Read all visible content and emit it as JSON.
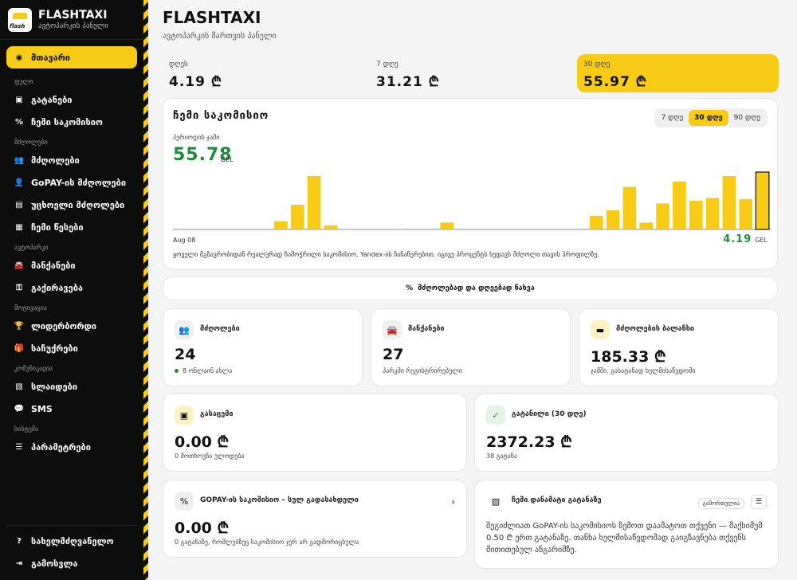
{
  "brand": {
    "title": "FLASHTAXI",
    "subtitle": "ავტოპარკის პანელი",
    "logo_text": "flash"
  },
  "sidebar": {
    "active": "მთავარი",
    "sec_money": "ფული",
    "trips": "გატანები",
    "my_commission": "ჩემი საკომისიო",
    "sec_drivers": "მძღოლები",
    "drivers": "მძღოლები",
    "gopay_drivers": "GoPAY-ის მძღოლები",
    "foreign_drivers": "უცხოელი მძღოლები",
    "my_rules": "ჩემი წესები",
    "sec_fleet": "ავტოპარკი",
    "cars": "მანქანები",
    "rental": "გაქირავება",
    "sec_motivation": "მოტივაცია",
    "leaderboard": "ლიდერბორდი",
    "gifts": "საჩუქრები",
    "sec_comm": "კომუნიკაცია",
    "slides": "სლაიდები",
    "sms": "SMS",
    "sec_system": "სისტემა",
    "settings": "პარამეტრები",
    "guide": "სახელმძღვანელო",
    "logout": "გამოსვლა"
  },
  "header": {
    "title": "FLASHTAXI",
    "subtitle": "ავტოპარკის მართვის პანელი"
  },
  "periods": [
    {
      "label": "დღეს",
      "value": "4.19 ₾"
    },
    {
      "label": "7 დღე",
      "value": "31.21 ₾"
    },
    {
      "label": "30 დღე",
      "value": "55.97 ₾"
    }
  ],
  "commission_card": {
    "title": "ჩემი საკომისიო",
    "tabs": [
      "7 დღე",
      "30 დღე",
      "90 დღე"
    ],
    "total_label": "პერიოდის ჯამი",
    "total": "55.78",
    "unit": "GEL",
    "start_date": "Aug 08",
    "last_value": "4.19",
    "last_unit": "GEL",
    "note": "ყოველი მგზავრობიდან რეალურად ჩამოჭრილი საკომისიო, Yandex-ის ჩანაწერებით. იგივე პროცენტს ხედავს მძღოლი თავის პროფილზე."
  },
  "chart_data": {
    "type": "bar",
    "title": "ჩემი საკომისიო",
    "x_start": "Aug 08",
    "values": [
      0,
      0,
      0,
      0,
      0,
      0,
      0.6,
      1.8,
      3.9,
      0.3,
      0,
      0,
      0,
      0.05,
      0,
      0,
      0.5,
      0,
      0,
      0,
      0,
      0,
      0,
      0,
      0,
      1,
      1.4,
      3.1,
      0.5,
      1.9,
      3.5,
      2.1,
      2.3,
      3.9,
      2.2
    ],
    "last_value": 4.19,
    "ylim": [
      0,
      4.19
    ],
    "grid": false
  },
  "drivers_days_button": "მძღოლებად და დღეებად ნახვა",
  "stats": {
    "drivers": {
      "title": "მძღოლები",
      "value": "24",
      "sub": "8 ონლაინ ახლა"
    },
    "cars": {
      "title": "მანქანები",
      "value": "27",
      "sub": "პარკში რეგისტრირებული"
    },
    "balance": {
      "title": "მძღოლების ბალანსი",
      "value": "185.33 ₾",
      "sub": "ჯამში, გასატანად ხელმისაწვდომი"
    },
    "expenses": {
      "title": "გასაცემი",
      "value": "0.00 ₾",
      "sub": "0 მოთხოვნა ელოდება"
    },
    "withdrawn": {
      "title": "გატანილი (30 დღე)",
      "value": "2372.23 ₾",
      "sub": "38 გატანა"
    },
    "gopay": {
      "title": "GOPAY-ის საკომისიო – სულ გადასახდელი",
      "value": "0.00 ₾",
      "sub": "0 გატანაზე, რომლებზეც საკომისიო ჯერ არ გადმორიცხულა"
    },
    "promo": {
      "title": "ჩემი დანამატი გატანაზე",
      "badge": "გამორთულია",
      "text": "შეგიძლიათ GoPAY-ის საკომისიოს ზემოთ დაამატოთ თქვენი — მაქსიმუმ 0.50 ₾ ერთ გატანაზე. თანხა ხელმისაწვდომად გაიგზავნება თქვენს მითითებულ ანგარიშზე."
    }
  }
}
